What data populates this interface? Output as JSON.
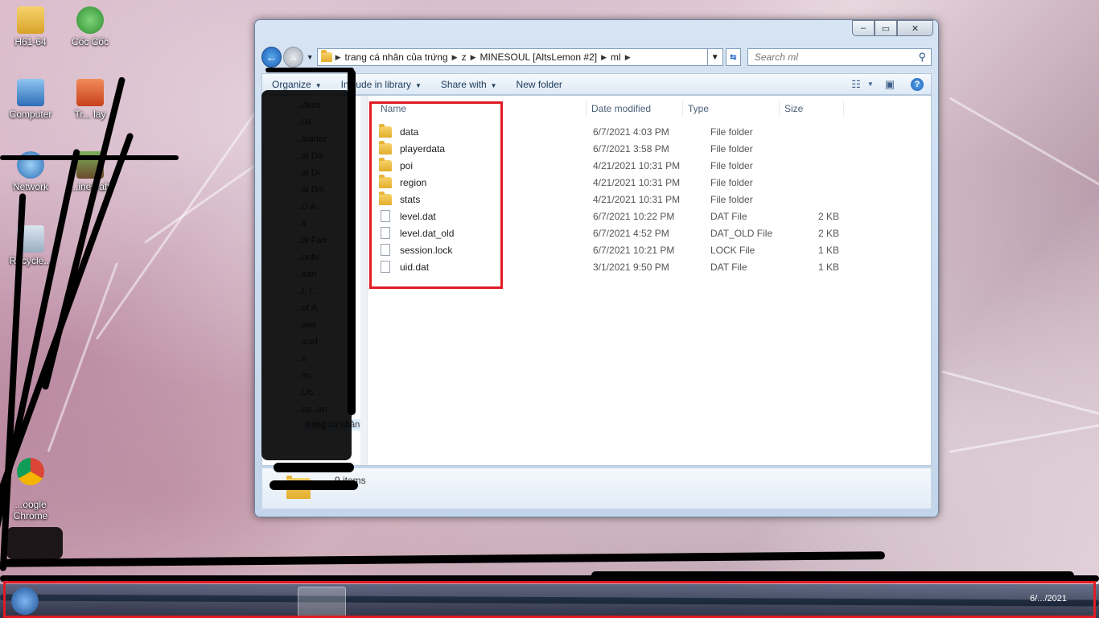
{
  "desktop": {
    "icons": [
      {
        "label": "H61-64"
      },
      {
        "label": "Cốc Cốc"
      },
      {
        "label": "Computer"
      },
      {
        "label": "Tr... lay"
      },
      {
        "label": "Network"
      },
      {
        "label": "...inecraft"
      },
      {
        "label": "Recycle..."
      },
      {
        "label": "...oogle\nChrome"
      }
    ]
  },
  "window": {
    "caption_buttons": {
      "minimize": "‒",
      "maximize": "▭",
      "close": "✕"
    },
    "breadcrumbs": [
      "trang cá nhân của trứng",
      "z",
      "MINESOUL [AltsLemon #2]",
      "ml"
    ],
    "search_placeholder": "Search ml",
    "toolbar": {
      "organize": "Organize",
      "include_in_library": "Include in library",
      "share_with": "Share with",
      "new_folder": "New folder"
    },
    "columns": {
      "name": "Name",
      "date": "Date modified",
      "type": "Type",
      "size": "Size"
    },
    "files": [
      {
        "name": "data",
        "date": "6/7/2021 4:03 PM",
        "type": "File folder",
        "size": "",
        "kind": "folder"
      },
      {
        "name": "playerdata",
        "date": "6/7/2021 3:58 PM",
        "type": "File folder",
        "size": "",
        "kind": "folder"
      },
      {
        "name": "poi",
        "date": "4/21/2021 10:31 PM",
        "type": "File folder",
        "size": "",
        "kind": "folder"
      },
      {
        "name": "region",
        "date": "4/21/2021 10:31 PM",
        "type": "File folder",
        "size": "",
        "kind": "folder"
      },
      {
        "name": "stats",
        "date": "4/21/2021 10:31 PM",
        "type": "File folder",
        "size": "",
        "kind": "folder"
      },
      {
        "name": "level.dat",
        "date": "6/7/2021 10:22 PM",
        "type": "DAT File",
        "size": "2 KB",
        "kind": "file"
      },
      {
        "name": "level.dat_old",
        "date": "6/7/2021 4:52 PM",
        "type": "DAT_OLD File",
        "size": "2 KB",
        "kind": "file"
      },
      {
        "name": "session.lock",
        "date": "6/7/2021 10:21 PM",
        "type": "LOCK File",
        "size": "1 KB",
        "kind": "file"
      },
      {
        "name": "uid.dat",
        "date": "3/1/2021 9:50 PM",
        "type": "DAT File",
        "size": "1 KB",
        "kind": "file"
      }
    ],
    "navpane_partial": [
      "...deos",
      "...04",
      "...loader",
      "...al Dis",
      "...al Di",
      "...al Dis",
      "...D A...",
      "...k",
      "...al Fan",
      "...onfu",
      "...ean",
      "...t, I...",
      "...of A...",
      "...wer",
      "...xcel",
      "...e",
      "...im",
      "...Ub...",
      "...ay...im"
    ],
    "navpane_selected": "trang cá nhân",
    "details_count": "9 items"
  },
  "taskbar": {
    "clock_date": "6/.../2021"
  },
  "colors": {
    "highlight_box": "#e01b24",
    "window_frame": "#c3d5ea"
  }
}
